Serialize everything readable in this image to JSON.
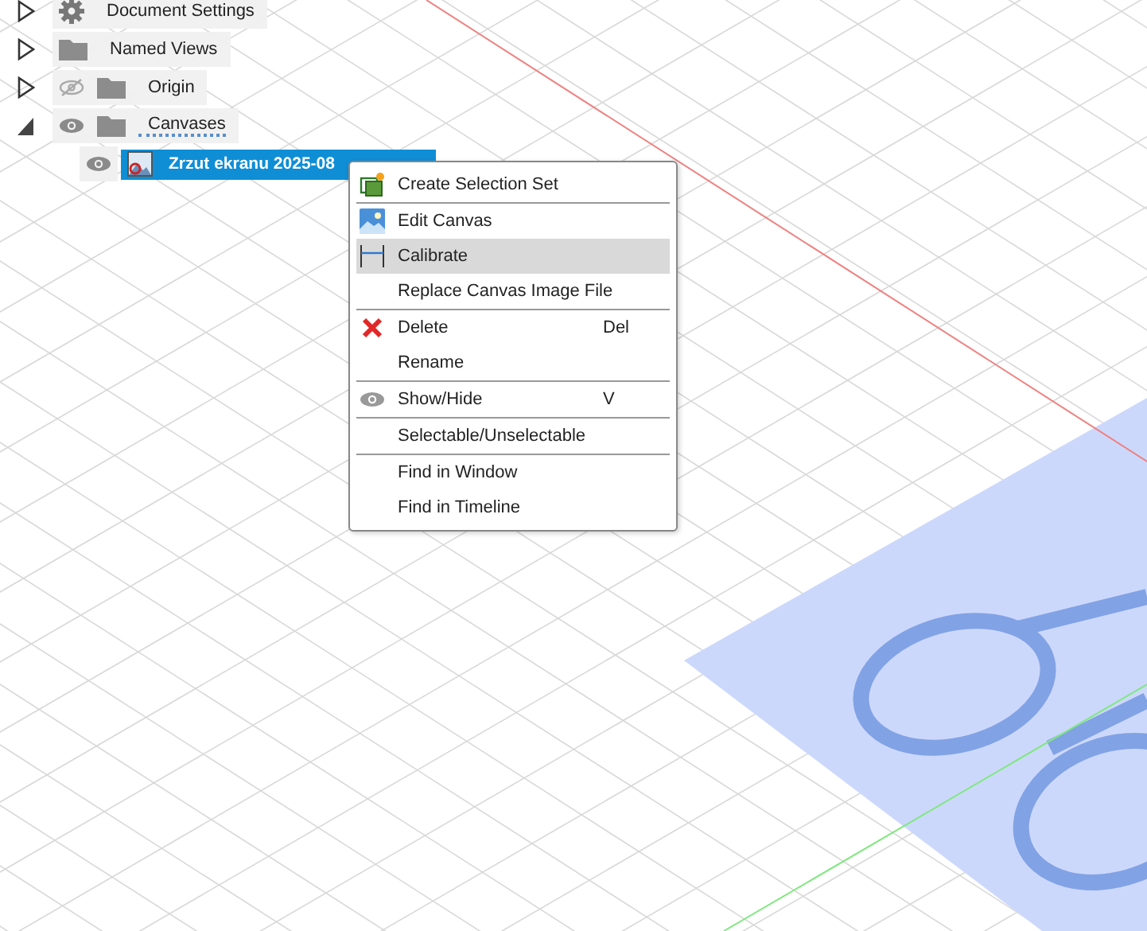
{
  "browser": {
    "items": [
      {
        "label": "Document Settings",
        "expanded": false,
        "kind": "settings"
      },
      {
        "label": "Named Views",
        "expanded": false,
        "kind": "folder"
      },
      {
        "label": "Origin",
        "expanded": false,
        "kind": "folder",
        "visible": false
      },
      {
        "label": "Canvases",
        "expanded": true,
        "kind": "folder",
        "visible": true,
        "children": [
          {
            "label": "Zrzut ekranu 2025-08",
            "selected": true,
            "visible": true
          }
        ]
      }
    ]
  },
  "context_menu": {
    "groups": [
      [
        {
          "label": "Create Selection Set",
          "highlighted": false
        }
      ],
      [
        {
          "label": "Edit Canvas",
          "highlighted": false
        },
        {
          "label": "Calibrate",
          "highlighted": true
        },
        {
          "label": "Replace Canvas Image File",
          "highlighted": false
        }
      ],
      [
        {
          "label": "Delete",
          "shortcut": "Del",
          "highlighted": false
        },
        {
          "label": "Rename",
          "highlighted": false
        }
      ],
      [
        {
          "label": "Show/Hide",
          "shortcut": "V",
          "highlighted": false
        }
      ],
      [
        {
          "label": "Selectable/Unselectable",
          "highlighted": false
        }
      ],
      [
        {
          "label": "Find in Window",
          "highlighted": false
        },
        {
          "label": "Find in Timeline",
          "highlighted": false
        }
      ]
    ]
  }
}
